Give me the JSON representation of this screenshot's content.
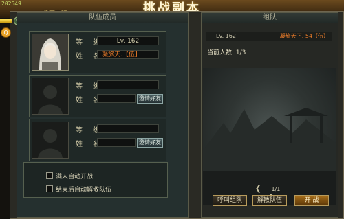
{
  "header": {
    "title": "挑战副本",
    "corner_number": "202549",
    "corner_logo": "我要变强",
    "plus": "+",
    "side_icon": "Q"
  },
  "team": {
    "title": "队伍成员",
    "level_label": "等 级",
    "name_label": "姓 名",
    "invite_label": "邀请好友",
    "members": [
      {
        "level": "Lv. 162",
        "name": "凝旅天.【伍】"
      },
      {
        "level": "",
        "name": ""
      },
      {
        "level": "",
        "name": ""
      }
    ],
    "options": [
      {
        "label": "满人自动开战"
      },
      {
        "label": "结束后自动解散队伍"
      }
    ]
  },
  "room": {
    "title": "组队",
    "list": [
      {
        "level": "Lv. 162",
        "name": "凝旅天下. 54【伍】"
      }
    ],
    "count_text": "当前人数: 1/3",
    "page": "1/1",
    "prev": "❮",
    "next": "❯",
    "buttons": {
      "call": "呼叫组队",
      "dismiss": "解散队伍",
      "start": "开 战"
    }
  }
}
